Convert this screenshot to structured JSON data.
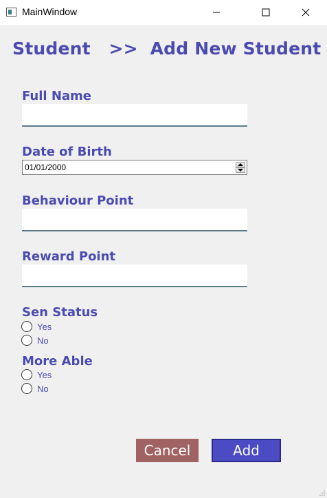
{
  "window": {
    "title": "MainWindow"
  },
  "header": {
    "breadcrumb": "Student   >>  Add New Student"
  },
  "form": {
    "full_name_label": "Full Name",
    "full_name_value": "",
    "dob_label": "Date of Birth",
    "dob_value": "01/01/2000",
    "behaviour_label": "Behaviour Point",
    "behaviour_value": "",
    "reward_label": "Reward Point",
    "reward_value": "",
    "sen_label": "Sen Status",
    "sen_options": [
      "Yes",
      "No"
    ],
    "more_able_label": "More Able",
    "more_able_options": [
      "Yes",
      "No"
    ]
  },
  "actions": {
    "cancel_label": "Cancel",
    "add_label": "Add"
  },
  "colors": {
    "accent": "#4a4ab0",
    "cancel": "#a06262",
    "add": "#4b4bc4"
  }
}
